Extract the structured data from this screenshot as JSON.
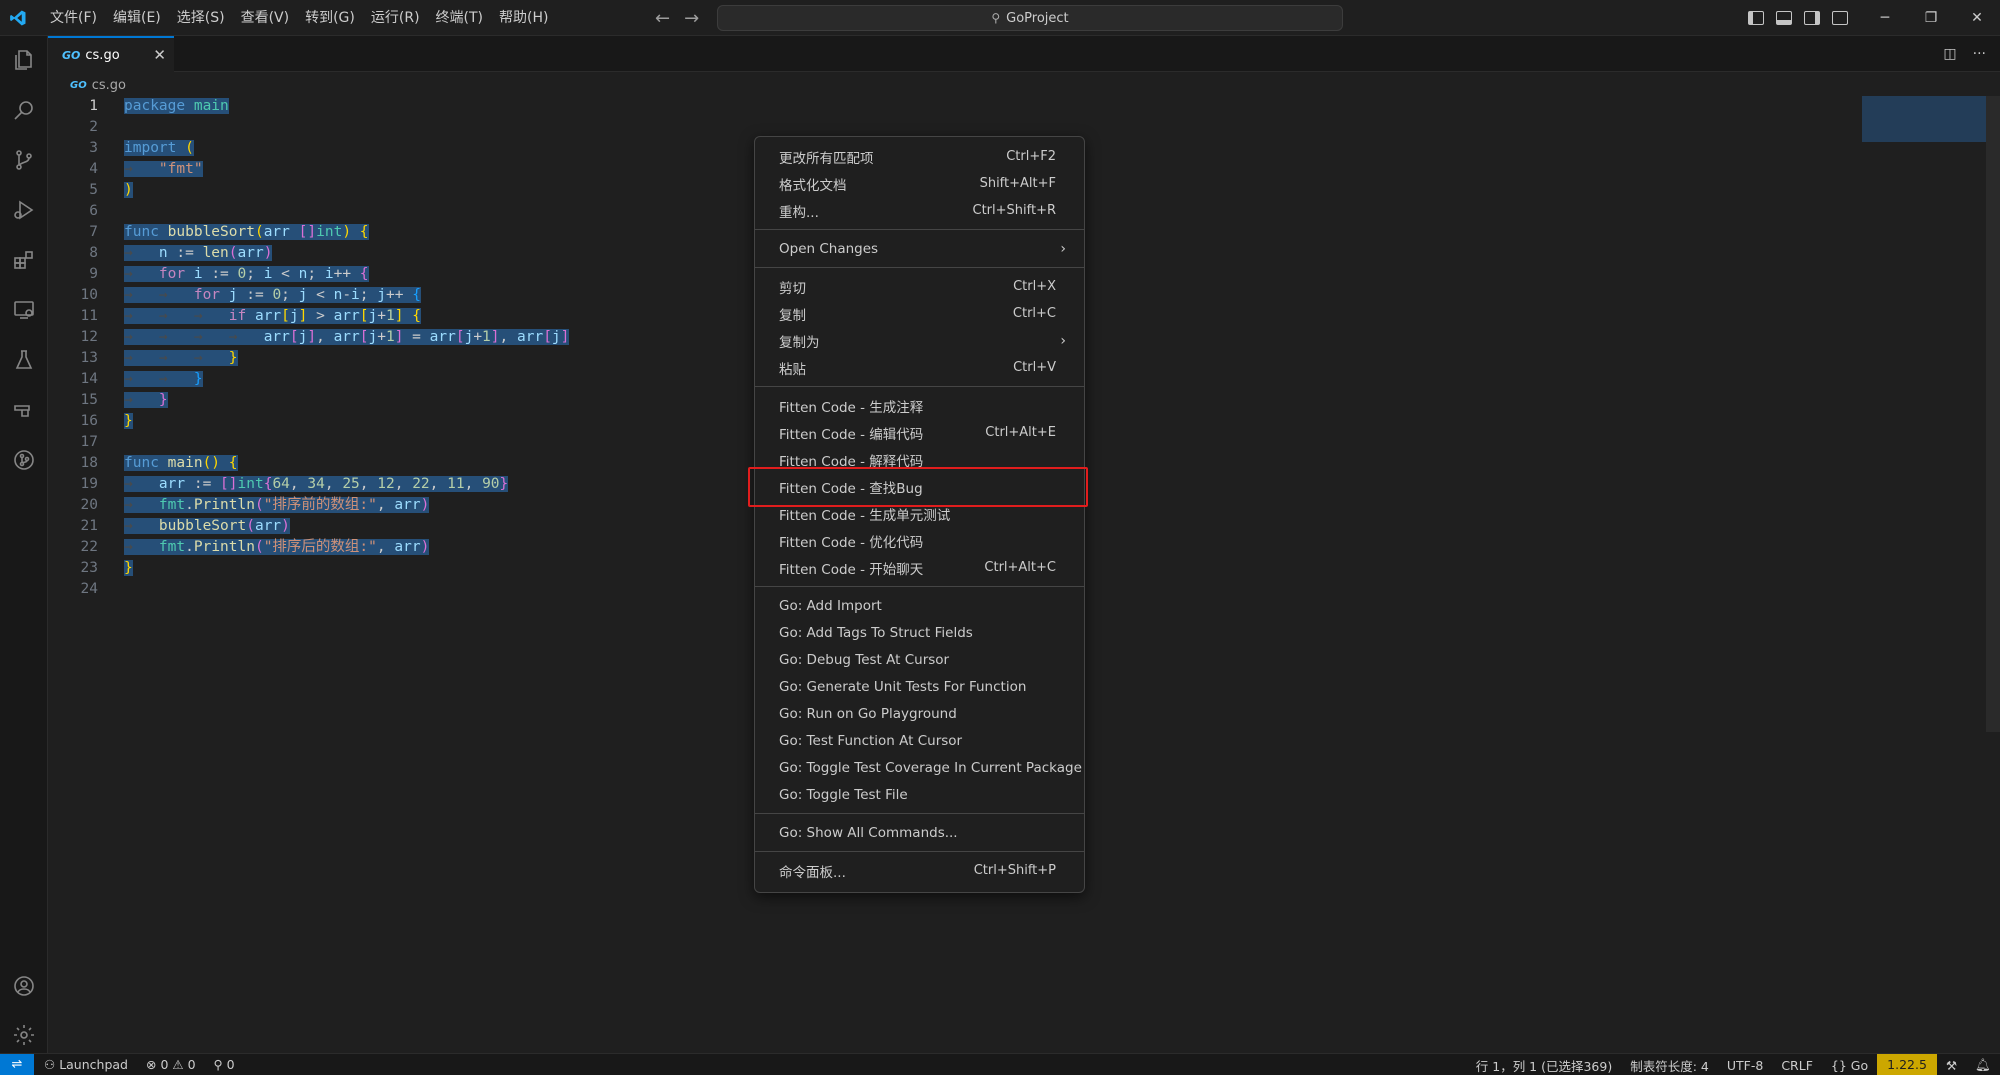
{
  "menubar": [
    "文件(F)",
    "编辑(E)",
    "选择(S)",
    "查看(V)",
    "转到(G)",
    "运行(R)",
    "终端(T)",
    "帮助(H)"
  ],
  "search": {
    "label": "GoProject"
  },
  "tab": {
    "name": "cs.go",
    "icon": "go-file-icon"
  },
  "breadcrumb": {
    "file": "cs.go"
  },
  "context_menu": {
    "group1": [
      {
        "label": "更改所有匹配项",
        "shortcut": "Ctrl+F2"
      },
      {
        "label": "格式化文档",
        "shortcut": "Shift+Alt+F"
      },
      {
        "label": "重构...",
        "shortcut": "Ctrl+Shift+R"
      }
    ],
    "group2": [
      {
        "label": "Open Changes",
        "shortcut": ""
      }
    ],
    "group3": [
      {
        "label": "剪切",
        "shortcut": "Ctrl+X"
      },
      {
        "label": "复制",
        "shortcut": "Ctrl+C"
      },
      {
        "label": "复制为",
        "shortcut": ""
      },
      {
        "label": "粘贴",
        "shortcut": "Ctrl+V"
      }
    ],
    "group4": [
      {
        "label": "Fitten Code - 生成注释",
        "shortcut": ""
      },
      {
        "label": "Fitten Code - 编辑代码",
        "shortcut": "Ctrl+Alt+E"
      },
      {
        "label": "Fitten Code - 解释代码",
        "shortcut": ""
      },
      {
        "label": "Fitten Code - 查找Bug",
        "shortcut": ""
      },
      {
        "label": "Fitten Code - 生成单元测试",
        "shortcut": ""
      },
      {
        "label": "Fitten Code - 优化代码",
        "shortcut": ""
      },
      {
        "label": "Fitten Code - 开始聊天",
        "shortcut": "Ctrl+Alt+C"
      }
    ],
    "group5": [
      {
        "label": "Go: Add Import"
      },
      {
        "label": "Go: Add Tags To Struct Fields"
      },
      {
        "label": "Go: Debug Test At Cursor"
      },
      {
        "label": "Go: Generate Unit Tests For Function"
      },
      {
        "label": "Go: Run on Go Playground"
      },
      {
        "label": "Go: Test Function At Cursor"
      },
      {
        "label": "Go: Toggle Test Coverage In Current Package"
      },
      {
        "label": "Go: Toggle Test File"
      }
    ],
    "group6": [
      {
        "label": "Go: Show All Commands..."
      }
    ],
    "group7": [
      {
        "label": "命令面板...",
        "shortcut": "Ctrl+Shift+P"
      }
    ]
  },
  "statusbar": {
    "launchpad": "Launchpad",
    "errors": "0",
    "warnings": "0",
    "ports": "0",
    "cursor": "行 1，列 1 (已选择369)",
    "tab_size": "制表符长度: 4",
    "encoding": "UTF-8",
    "eol": "CRLF",
    "language": "Go",
    "go_version": "1.22.5"
  },
  "colors": {
    "accent": "#0078d4",
    "highlight_box": "#e11d1d",
    "go_version_bg": "#cca700"
  }
}
